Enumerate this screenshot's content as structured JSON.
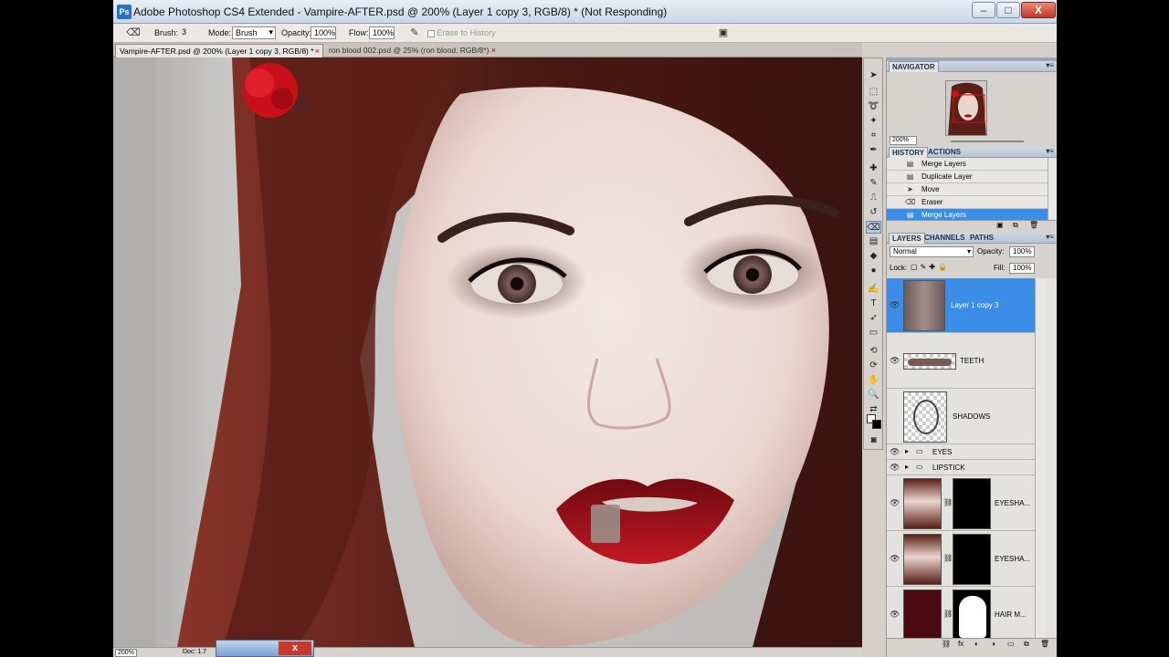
{
  "window": {
    "title": "Adobe Photoshop CS4 Extended - Vampire-AFTER.psd @ 200% (Layer 1 copy 3, RGB/8) * (Not Responding)",
    "minimize": "–",
    "maximize": "□",
    "close": "X"
  },
  "options": {
    "brush_label": "Brush:",
    "brush_size": "3",
    "mode_label": "Mode:",
    "mode_value": "Brush",
    "opacity_label": "Opacity:",
    "opacity_value": "100%",
    "flow_label": "Flow:",
    "flow_value": "100%",
    "erase_history": "Erase to History"
  },
  "doc_tabs": [
    {
      "label": "Vampire-AFTER.psd @ 200% (Layer 1 copy 3, RGB/8) *",
      "close": "×"
    },
    {
      "label": "ron blood 002.psd @ 25% (ron blood, RGB/8*)",
      "close": "×"
    }
  ],
  "status": {
    "zoom": "200%",
    "doc": "Doc: 1.7"
  },
  "navigator": {
    "tab": "NAVIGATOR",
    "zoom": "200%"
  },
  "history": {
    "tabs": [
      "HISTORY",
      "ACTIONS"
    ],
    "items": [
      {
        "label": "Merge Layers",
        "icon": "merge-icon",
        "active": false
      },
      {
        "label": "Duplicate Layer",
        "icon": "layer-icon",
        "active": false
      },
      {
        "label": "Move",
        "icon": "move-icon",
        "active": false
      },
      {
        "label": "Eraser",
        "icon": "eraser-icon",
        "active": false
      },
      {
        "label": "Merge Layers",
        "icon": "merge-icon",
        "active": true
      }
    ]
  },
  "layers": {
    "tabs": [
      "LAYERS",
      "CHANNELS",
      "PATHS"
    ],
    "blend_mode": "Normal",
    "opacity_label": "Opacity:",
    "opacity_value": "100%",
    "lock_label": "Lock:",
    "fill_label": "Fill:",
    "fill_value": "100%",
    "items": [
      {
        "name": "Layer 1 copy 3"
      },
      {
        "name": "TEETH"
      },
      {
        "name": "SHADOWS"
      },
      {
        "name": "EYES"
      },
      {
        "name": "LIPSTICK"
      },
      {
        "name": "EYESHA..."
      },
      {
        "name": "EYESHA..."
      },
      {
        "name": "HAIR M..."
      }
    ]
  },
  "colors": {
    "accent": "#3a8ee8",
    "hair": "#6e2a22",
    "lips": "#8e0f16",
    "skin": "#ecd9d2"
  }
}
